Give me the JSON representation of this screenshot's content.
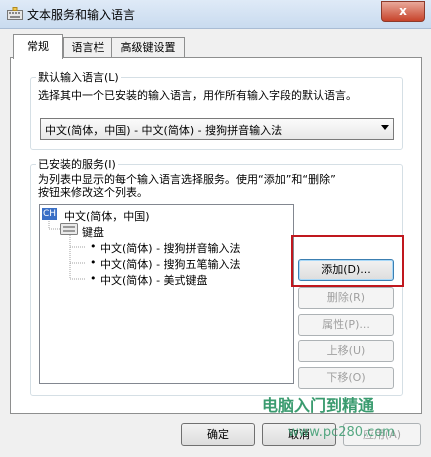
{
  "window": {
    "title": "文本服务和输入语言",
    "close": "x"
  },
  "tabs": [
    {
      "label": "常规"
    },
    {
      "label": "语言栏"
    },
    {
      "label": "高级键设置"
    }
  ],
  "default_lang": {
    "group_title": "默认输入语言(L)",
    "description": "选择其中一个已安装的输入语言，用作所有输入字段的默认语言。",
    "selected": "中文(简体，中国) - 中文(简体) - 搜狗拼音输入法"
  },
  "installed": {
    "group_title": "已安装的服务(I)",
    "description_line1": "为列表中显示的每个输入语言选择服务。使用“添加”和“删除”",
    "description_line2": "按钮来修改这个列表。",
    "tree": {
      "lang_badge": "CH",
      "lang_label": "中文(简体，中国)",
      "keyboard_label": "键盘",
      "items": [
        "中文(简体) - 搜狗拼音输入法",
        "中文(简体) - 搜狗五笔输入法",
        "中文(简体) - 美式键盘"
      ]
    },
    "buttons": {
      "add": "添加(D)...",
      "remove": "删除(R)",
      "properties": "属性(P)...",
      "move_up": "上移(U)",
      "move_down": "下移(O)"
    }
  },
  "footer": {
    "ok": "确定",
    "cancel": "取消",
    "apply": "应用(A)"
  },
  "watermark": {
    "line1": "电脑入门到精通",
    "line2": "www.pc280.com"
  }
}
